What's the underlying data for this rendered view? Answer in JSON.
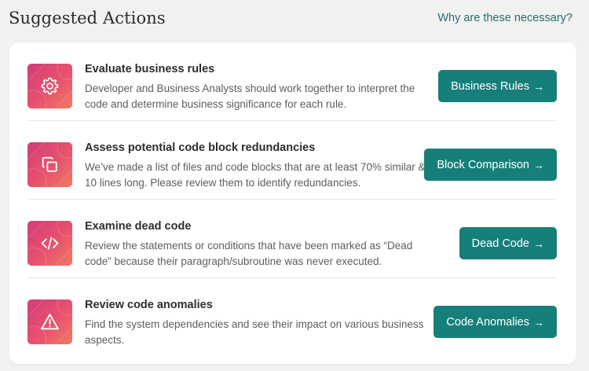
{
  "header": {
    "title": "Suggested Actions",
    "help_link": "Why are these necessary?"
  },
  "colors": {
    "button": "#177f7a",
    "link": "#236e72",
    "icon_gradient_start": "#d23c77",
    "icon_gradient_end": "#f07a63"
  },
  "actions": [
    {
      "icon": "gear-icon",
      "title": "Evaluate business rules",
      "description": "Developer and Business Analysts should work together to interpret the code and determine business significance for each rule.",
      "button_label": "Business Rules",
      "button_arrow": "→"
    },
    {
      "icon": "copy-icon",
      "title": "Assess potential code block redundancies",
      "description": "We’ve made a list of files and code blocks that are at least 70% similar & 10 lines long. Please review them to identify redundancies.",
      "button_label": "Block Comparison",
      "button_arrow": "→"
    },
    {
      "icon": "code-icon",
      "title": "Examine dead code",
      "description": "Review the statements or conditions that have been marked as “Dead code” because their paragraph/subroutine was never executed.",
      "button_label": "Dead Code",
      "button_arrow": "→"
    },
    {
      "icon": "warning-icon",
      "title": "Review code anomalies",
      "description": "Find the system dependencies and see their impact on various business aspects.",
      "button_label": "Code Anomalies",
      "button_arrow": "→"
    }
  ]
}
